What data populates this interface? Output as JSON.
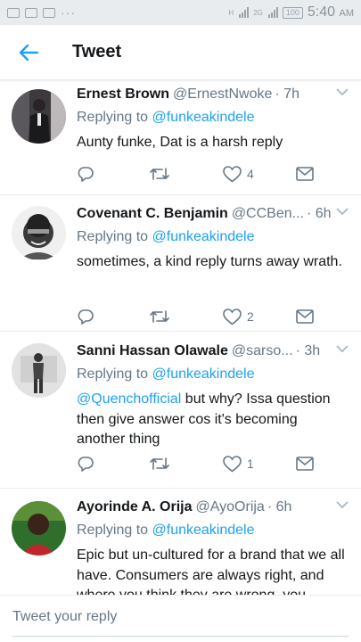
{
  "status_bar": {
    "time": "5:40",
    "ampm": "AM",
    "battery": "100",
    "network_a": "H",
    "network_b": "2G"
  },
  "header": {
    "title": "Tweet",
    "back_icon": "arrow-left-icon",
    "accent": "#1da1f2"
  },
  "tweets": [
    {
      "name": "Ernest Brown",
      "handle": "@ErnestNwoke",
      "time": "· 7h",
      "replying_prefix": "Replying to",
      "replying_to": "@funkeakindele",
      "text_mention": "",
      "text": "Aunty funke, Dat is a harsh reply",
      "likes": "4"
    },
    {
      "name": "Covenant C. Benjamin",
      "handle": "@CCBen...",
      "time": "· 6h",
      "replying_prefix": "Replying to",
      "replying_to": "@funkeakindele",
      "text_mention": "",
      "text": "sometimes, a kind reply turns away wrath.",
      "likes": "2"
    },
    {
      "name": "Sanni Hassan Olawale",
      "handle": "@sarso...",
      "time": "· 3h",
      "replying_prefix": "Replying to",
      "replying_to": "@funkeakindele",
      "text_mention": "@Quenchofficial",
      "text": " but why? Issa question then give answer cos it's becoming another thing",
      "likes": "1"
    },
    {
      "name": "Ayorinde A. Orija",
      "handle": "@AyoOrija",
      "time": "· 6h",
      "replying_prefix": "Replying to",
      "replying_to": "@funkeakindele",
      "text_mention": "",
      "text": "Epic but un-cultured for a brand that we all have. Consumers are always right, and where you think they are wrong, you",
      "likes": ""
    }
  ],
  "compose": {
    "placeholder": "Tweet your reply"
  }
}
